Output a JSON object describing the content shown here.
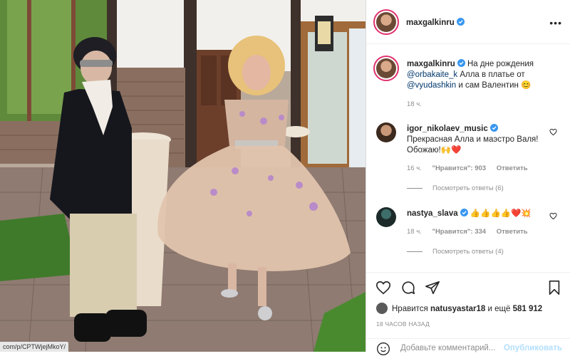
{
  "photo": {
    "status_url": "com/p/CPTWjejMkoY/"
  },
  "post": {
    "author": "maxgalkinru",
    "caption_author": "maxgalkinru",
    "caption_part1": "На дне рождения",
    "mention1": "@orbakaite_k",
    "caption_part2": "Алла в платье от",
    "mention2": "@vyudashkin",
    "caption_part3": "и сам Валентин 😊",
    "caption_time": "18 ч."
  },
  "comments": [
    {
      "username": "igor_nikolaev_music",
      "text": "Прекрасная Алла и маэстро Валя! Обожаю!🙌❤️",
      "time": "16 ч.",
      "likes_label": "\"Нравится\": 903",
      "reply": "Ответить",
      "view_replies": "Посмотреть ответы (6)"
    },
    {
      "username": "nastya_slava",
      "text": "👍👍👍👍❤️💥",
      "time": "18 ч.",
      "likes_label": "\"Нравится\": 334",
      "reply": "Ответить",
      "view_replies": "Посмотреть ответы (4)"
    }
  ],
  "likes": {
    "prefix": "Нравится",
    "user": "natusyastar18",
    "middle": "и ещё",
    "count": "581 912"
  },
  "time_ago": "18 ЧАСОВ НАЗАД",
  "comment_box": {
    "placeholder": "Добавьте комментарий...",
    "publish": "Опубликовать"
  },
  "icons": {
    "like": "heart-icon",
    "comment": "comment-icon",
    "share": "paper-plane-icon",
    "save": "bookmark-icon",
    "emoji": "smiley-icon",
    "verified": "verified-badge-icon"
  },
  "colors": {
    "verified": "#3897f0",
    "link": "#00376b",
    "secondary_text": "#8e8e8e",
    "publish_disabled": "#b2dffc",
    "heart": "#ed4956"
  }
}
